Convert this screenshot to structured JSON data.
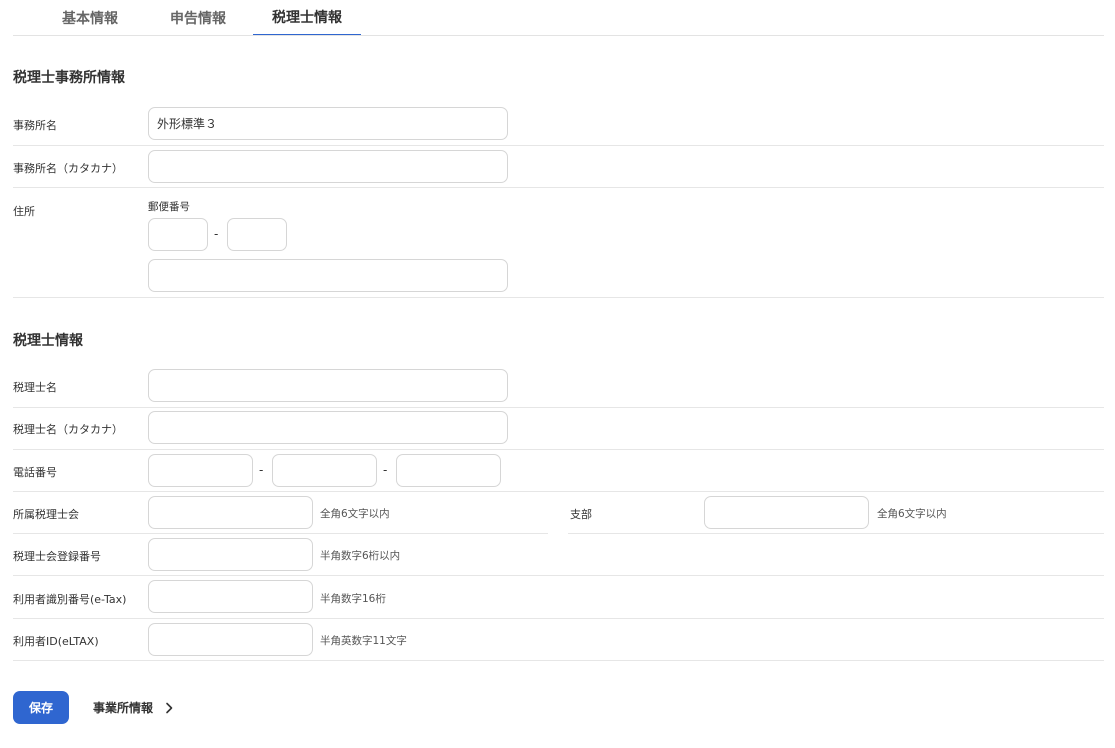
{
  "tabs": [
    {
      "label": "基本情報"
    },
    {
      "label": "申告情報"
    },
    {
      "label": "税理士情報"
    }
  ],
  "office_section": {
    "title": "税理士事務所情報",
    "office_name_label": "事務所名",
    "office_name_value": "外形標準３",
    "office_kana_label": "事務所名（カタカナ）",
    "office_kana_value": "",
    "address_label": "住所",
    "postal_label": "郵便番号",
    "postal_dash": "-",
    "postal1_value": "",
    "postal2_value": "",
    "address_value": ""
  },
  "accountant_section": {
    "title": "税理士情報",
    "name_label": "税理士名",
    "name_value": "",
    "kana_label": "税理士名（カタカナ）",
    "kana_value": "",
    "phone_label": "電話番号",
    "phone_dash": "-",
    "phone1_value": "",
    "phone2_value": "",
    "phone3_value": "",
    "association_label": "所属税理士会",
    "association_hint": "全角6文字以内",
    "association_value": "",
    "branch_label": "支部",
    "branch_hint": "全角6文字以内",
    "branch_value": "",
    "registration_label": "税理士会登録番号",
    "registration_hint": "半角数字6桁以内",
    "registration_value": "",
    "etax_label": "利用者識別番号(e-Tax)",
    "etax_hint": "半角数字16桁",
    "etax_value": "",
    "eltax_label": "利用者ID(eLTAX)",
    "eltax_hint": "半角英数字11文字",
    "eltax_value": ""
  },
  "footer": {
    "save_label": "保存",
    "next_label": "事業所情報"
  },
  "icons": {
    "next": "chevron-right-icon"
  },
  "colors": {
    "accent": "#2f66d0",
    "border": "#d6d6d6",
    "divider": "#e6e6e6"
  }
}
